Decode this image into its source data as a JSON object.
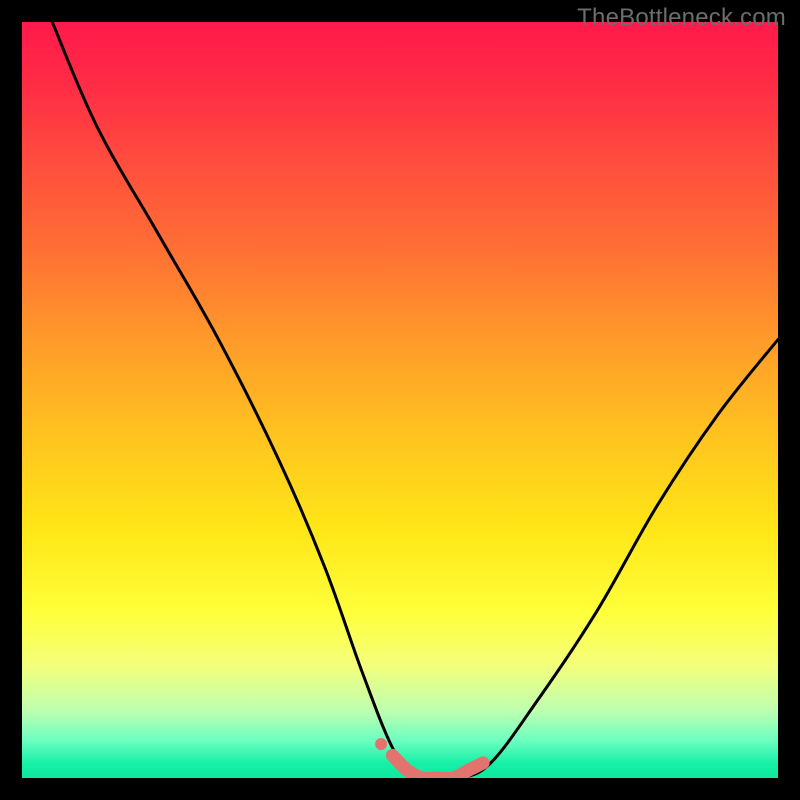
{
  "watermark": "TheBottleneck.com",
  "chart_data": {
    "type": "line",
    "title": "",
    "xlabel": "",
    "ylabel": "",
    "xlim": [
      0,
      100
    ],
    "ylim": [
      0,
      100
    ],
    "series": [
      {
        "name": "bottleneck-curve",
        "x": [
          4,
          10,
          18,
          26,
          34,
          40,
          45,
          49,
          52,
          55,
          58,
          62,
          68,
          76,
          84,
          92,
          100
        ],
        "values": [
          100,
          86,
          72,
          58,
          42,
          28,
          14,
          4,
          0,
          0,
          0,
          2,
          10,
          22,
          36,
          48,
          58
        ]
      }
    ],
    "highlight": {
      "name": "optimal-range",
      "x": [
        49,
        51,
        53,
        55,
        57,
        59,
        61
      ],
      "values": [
        3,
        1,
        0,
        0,
        0,
        1,
        2
      ]
    },
    "highlight_dot": {
      "x": 47.5,
      "value": 4.5
    }
  },
  "colors": {
    "curve": "#000000",
    "highlight": "#e2736e",
    "watermark": "#6d6d6d"
  }
}
